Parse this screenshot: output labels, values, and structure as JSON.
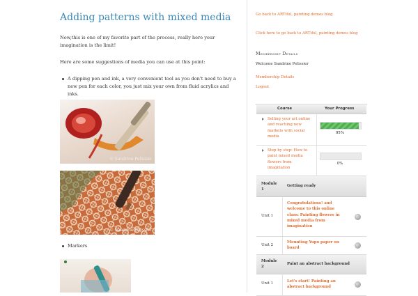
{
  "post": {
    "title": "Adding patterns with mixed media",
    "intro": "Now,this is one of my favorite part of the process, really here your imagination is the limit!",
    "suggestions": "Here are some suggestions of media you can use at this point:",
    "bullets": [
      "A dipping pen and ink, a very convenient tool as you don't need to buy a new pen for each color, you just mix your own from fluid acrylics and inks.",
      "Markers"
    ],
    "photo_credit": "© Sandrine Pelissier"
  },
  "sidebar": {
    "back_link_1": "Go back to ARTiful, painting demos blog",
    "back_link_2": "Click here to go back to ARTiful, painting demos blog",
    "membership_heading": "Membership Details",
    "welcome": "Welcome Sandrine Pelissier",
    "membership_link": "Membership Details",
    "logout": "Logout"
  },
  "course_table": {
    "col_course": "Course",
    "col_progress": "Your Progress",
    "courses": [
      {
        "name": "Selling your art online and reaching new markets with social media",
        "progress": 0.95,
        "progress_label": "95%"
      },
      {
        "name": "Step by step: How to paint mixed media flowers from imagination",
        "progress": 0,
        "progress_label": "0%"
      }
    ],
    "modules": [
      {
        "label": "Module 1",
        "title": "Getting ready"
      },
      {
        "label": "Module 2",
        "title": "Paint an abstract background"
      }
    ],
    "units": [
      {
        "label": "Unit 1",
        "title": "Congratulations! and welcome to this online class: Painting flowers in mixed media from imagination"
      },
      {
        "label": "Unit 2",
        "title": "Mounting Yupo paper on board"
      },
      {
        "label": "Unit 1",
        "title": "Let's start! Painting an abstract background"
      }
    ]
  },
  "colors": {
    "title": "#3a87b5",
    "link": "#e06a2c",
    "progress": "#4fae4f"
  }
}
